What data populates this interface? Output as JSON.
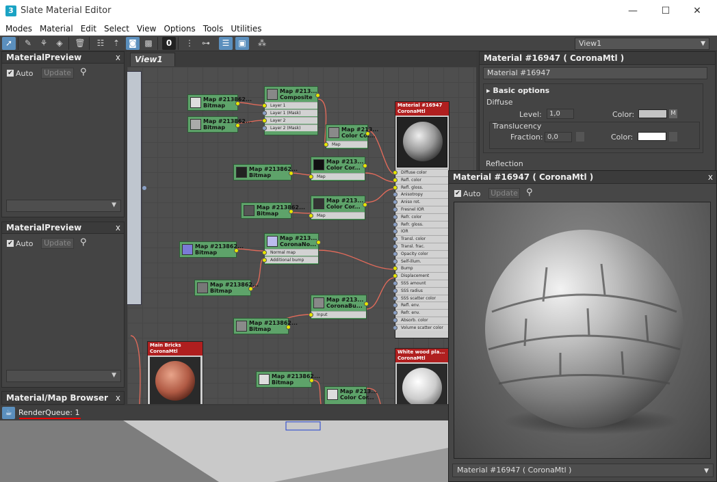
{
  "window": {
    "title": "Slate Material Editor",
    "app_icon": "3",
    "minimize": "—",
    "maximize": "☐",
    "close": "✕"
  },
  "menu": [
    "Modes",
    "Material",
    "Edit",
    "Select",
    "View",
    "Options",
    "Tools",
    "Utilities"
  ],
  "toolbar": {
    "icons": [
      "select-arrow-icon",
      "eyedropper-icon",
      "pick-material-icon",
      "assign-icon",
      "delete-icon",
      "layout-icon",
      "move-children-icon",
      "show-map-icon",
      "show-bg-icon",
      "count-icon",
      "layout-all-icon",
      "layout-children-icon",
      "list-view-icon",
      "preview-icon",
      "nav-icon"
    ],
    "count_label": "0",
    "view_select": "View1"
  },
  "left_panels": {
    "preview1": {
      "title": "MaterialPreview",
      "close": "x",
      "auto_label": "Auto",
      "update_label": "Update"
    },
    "preview2": {
      "title": "MaterialPreview",
      "close": "x",
      "auto_label": "Auto",
      "update_label": "Update"
    },
    "browser": {
      "title": "Material/Map Browser",
      "close": "x"
    }
  },
  "view_tab": "View1",
  "nodes": {
    "n1": {
      "t1": "Map #213862...",
      "t2": "Bitmap"
    },
    "n2": {
      "t1": "Map #213862...",
      "t2": "Bitmap"
    },
    "composite": {
      "t1": "Map #213...",
      "t2": "Composite",
      "slots": [
        "Layer 1",
        "Layer 1 (Mask)",
        "Layer 2",
        "Layer 2 (Mask)"
      ]
    },
    "cc1": {
      "t1": "Map #213...",
      "t2": "Color Cor...",
      "slot": "Map"
    },
    "n3": {
      "t1": "Map #213862...",
      "t2": "Bitmap"
    },
    "cc2": {
      "t1": "Map #213...",
      "t2": "Color Cor...",
      "slot": "Map"
    },
    "n4": {
      "t1": "Map #213862...",
      "t2": "Bitmap"
    },
    "cc3": {
      "t1": "Map #213...",
      "t2": "Color Cor...",
      "slot": "Map"
    },
    "n5": {
      "t1": "Map #213862...",
      "t2": "Bitmap"
    },
    "normal": {
      "t1": "Map #213...",
      "t2": "CoronaNo...",
      "slots": [
        "Normal map",
        "Additional bump"
      ]
    },
    "n6": {
      "t1": "Map #213862...",
      "t2": "Bitmap"
    },
    "bump": {
      "t1": "Map #213...",
      "t2": "CoronaBu...",
      "slot": "Input"
    },
    "n7": {
      "t1": "Map #213862...",
      "t2": "Bitmap"
    },
    "n8": {
      "t1": "Map #213862...",
      "t2": "Bitmap"
    },
    "cc4": {
      "t1": "Map #213...",
      "t2": "Color Cor..."
    }
  },
  "material_node": {
    "t1": "Material #16947",
    "t2": "CoronaMtl",
    "slots": [
      "Diffuse color",
      "Refl. color",
      "Refl. gloss.",
      "Anisotropy",
      "Aniso rot.",
      "Fresnel IOR",
      "Refr. color",
      "Refr. gloss.",
      "IOR",
      "Transl. color",
      "Transl. frac.",
      "Opacity color",
      "Self-illum.",
      "Bump",
      "Displacement",
      "SSS amount",
      "SSS radius",
      "SSS scatter color",
      "Refl. env.",
      "Refr. env.",
      "Absorb. color",
      "Volume scatter color"
    ]
  },
  "main_bricks_node": {
    "t1": "Main Bricks",
    "t2": "CoronaMtl"
  },
  "white_node": {
    "t1": "White wood pla...",
    "t2": "CoronaMtl"
  },
  "params": {
    "title": "Material #16947  ( CoronaMtl )",
    "name_field": "Material #16947",
    "rollout": "Basic options",
    "diffuse_group": "Diffuse",
    "level_label": "Level:",
    "level_value": "1,0",
    "color_label": "Color:",
    "map_button": "M",
    "translucency_group": "Translucency",
    "fraction_label": "Fraction:",
    "fraction_value": "0,0",
    "color2_label": "Color:",
    "reflection_label": "Reflection",
    "diffuse_color": "#c4c4c4",
    "transl_color": "#ffffff"
  },
  "preview_window": {
    "title": "Material #16947  ( CoronaMtl )",
    "close": "x",
    "auto_label": "Auto",
    "update_label": "Update",
    "footer_select": "Material #16947  ( CoronaMtl )"
  },
  "status": {
    "render_queue": "RenderQueue: 1"
  }
}
